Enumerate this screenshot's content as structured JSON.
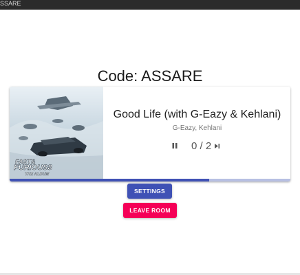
{
  "window": {
    "title_fragment": "SSARE"
  },
  "room": {
    "code_label": "Code: ASSARE"
  },
  "player": {
    "album_cover_text": {
      "line1": "FAST&",
      "line2": "FURIOUS8",
      "line3": "THE ALBUM"
    },
    "song_title": "Good Life (with G-Eazy & Kehlani)",
    "artist": "G-Eazy, Kehlani",
    "votes": "0 / 2",
    "progress_fraction": 0.71,
    "icons": {
      "pause": "pause-icon",
      "skip": "skip-next-icon"
    }
  },
  "actions": {
    "settings_label": "SETTINGS",
    "leave_label": "LEAVE ROOM"
  },
  "colors": {
    "primary": "#3f51b5",
    "secondary": "#f50057",
    "progress_track": "#b7bfe2"
  }
}
